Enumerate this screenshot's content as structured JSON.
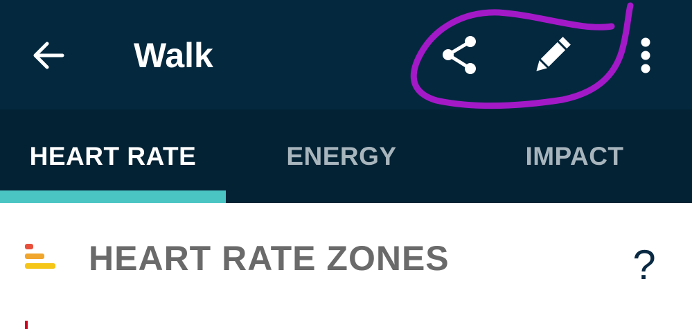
{
  "app_bar": {
    "title": "Walk",
    "back_icon": "back-arrow-icon",
    "share_icon": "share-icon",
    "edit_icon": "pencil-icon",
    "more_icon": "more-vert-icon"
  },
  "tabs": [
    {
      "label": "HEART RATE",
      "selected": true
    },
    {
      "label": "ENERGY",
      "selected": false
    },
    {
      "label": "IMPACT",
      "selected": false
    }
  ],
  "section": {
    "title": "HEART RATE ZONES",
    "icon": "zones-bars-icon",
    "help_label": "?"
  },
  "colors": {
    "app_bar_bg": "#04293f",
    "tab_bar_bg": "#032234",
    "tab_indicator": "#4bc5c4",
    "annotation": "#a319c8",
    "zone_high": "#e8503c",
    "zone_mid": "#f0a52c",
    "zone_low": "#f5c518"
  }
}
